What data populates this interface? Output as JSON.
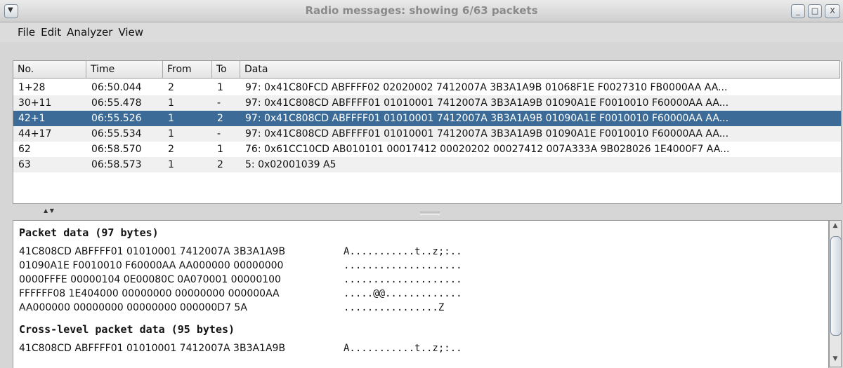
{
  "window": {
    "title": "Radio messages: showing 6/63 packets",
    "buttons": {
      "minimize": "_",
      "maximize": "□",
      "close": "X"
    }
  },
  "menu": [
    "File",
    "Edit",
    "Analyzer",
    "View"
  ],
  "table": {
    "columns": [
      "No.",
      "Time",
      "From",
      "To",
      "Data"
    ],
    "rows": [
      {
        "no": "1+28",
        "time": "06:50.044",
        "from": "2",
        "to": "1",
        "data": "97: 0x41C80FCD ABFFFF02 02020002 7412007A 3B3A1A9B 01068F1E F0027310 FB0000AA AA..."
      },
      {
        "no": "30+11",
        "time": "06:55.478",
        "from": "1",
        "to": "-",
        "data": "97: 0x41C808CD ABFFFF01 01010001 7412007A 3B3A1A9B 01090A1E F0010010 F60000AA AA..."
      },
      {
        "no": "42+1",
        "time": "06:55.526",
        "from": "1",
        "to": "2",
        "data": "97: 0x41C808CD ABFFFF01 01010001 7412007A 3B3A1A9B 01090A1E F0010010 F60000AA AA..."
      },
      {
        "no": "44+17",
        "time": "06:55.534",
        "from": "1",
        "to": "-",
        "data": "97: 0x41C808CD ABFFFF01 01010001 7412007A 3B3A1A9B 01090A1E F0010010 F60000AA AA..."
      },
      {
        "no": "62",
        "time": "06:58.570",
        "from": "2",
        "to": "1",
        "data": "76: 0x61CC10CD AB010101 00017412 00020202 00027412 007A333A 9B028026 1E4000F7 AA..."
      },
      {
        "no": "63",
        "time": "06:58.573",
        "from": "1",
        "to": "2",
        "data": "5: 0x02001039 A5"
      }
    ],
    "selected_index": 2
  },
  "detail": {
    "packet_title": "Packet data (97 bytes)",
    "packet_lines": [
      {
        "hex": "41C808CD ABFFFF01 01010001 7412007A 3B3A1A9B",
        "ascii": "A...........t..z;:.."
      },
      {
        "hex": "01090A1E F0010010 F60000AA AA000000 00000000",
        "ascii": "...................."
      },
      {
        "hex": "0000FFFE 00000104 0E00080C 0A070001 00000100",
        "ascii": "...................."
      },
      {
        "hex": "FFFFFF08 1E404000 00000000 00000000 000000AA",
        "ascii": ".....@@............."
      },
      {
        "hex": "AA000000 00000000 00000000 000000D7 5A",
        "ascii": "................Z"
      }
    ],
    "cross_title": "Cross-level packet data (95 bytes)",
    "cross_lines": [
      {
        "hex": "41C808CD ABFFFF01 01010001 7412007A 3B3A1A9B",
        "ascii": "A...........t..z;:.."
      }
    ]
  },
  "colors": {
    "selection": "#3b6b96",
    "row_alt": "#f0f0f0"
  }
}
